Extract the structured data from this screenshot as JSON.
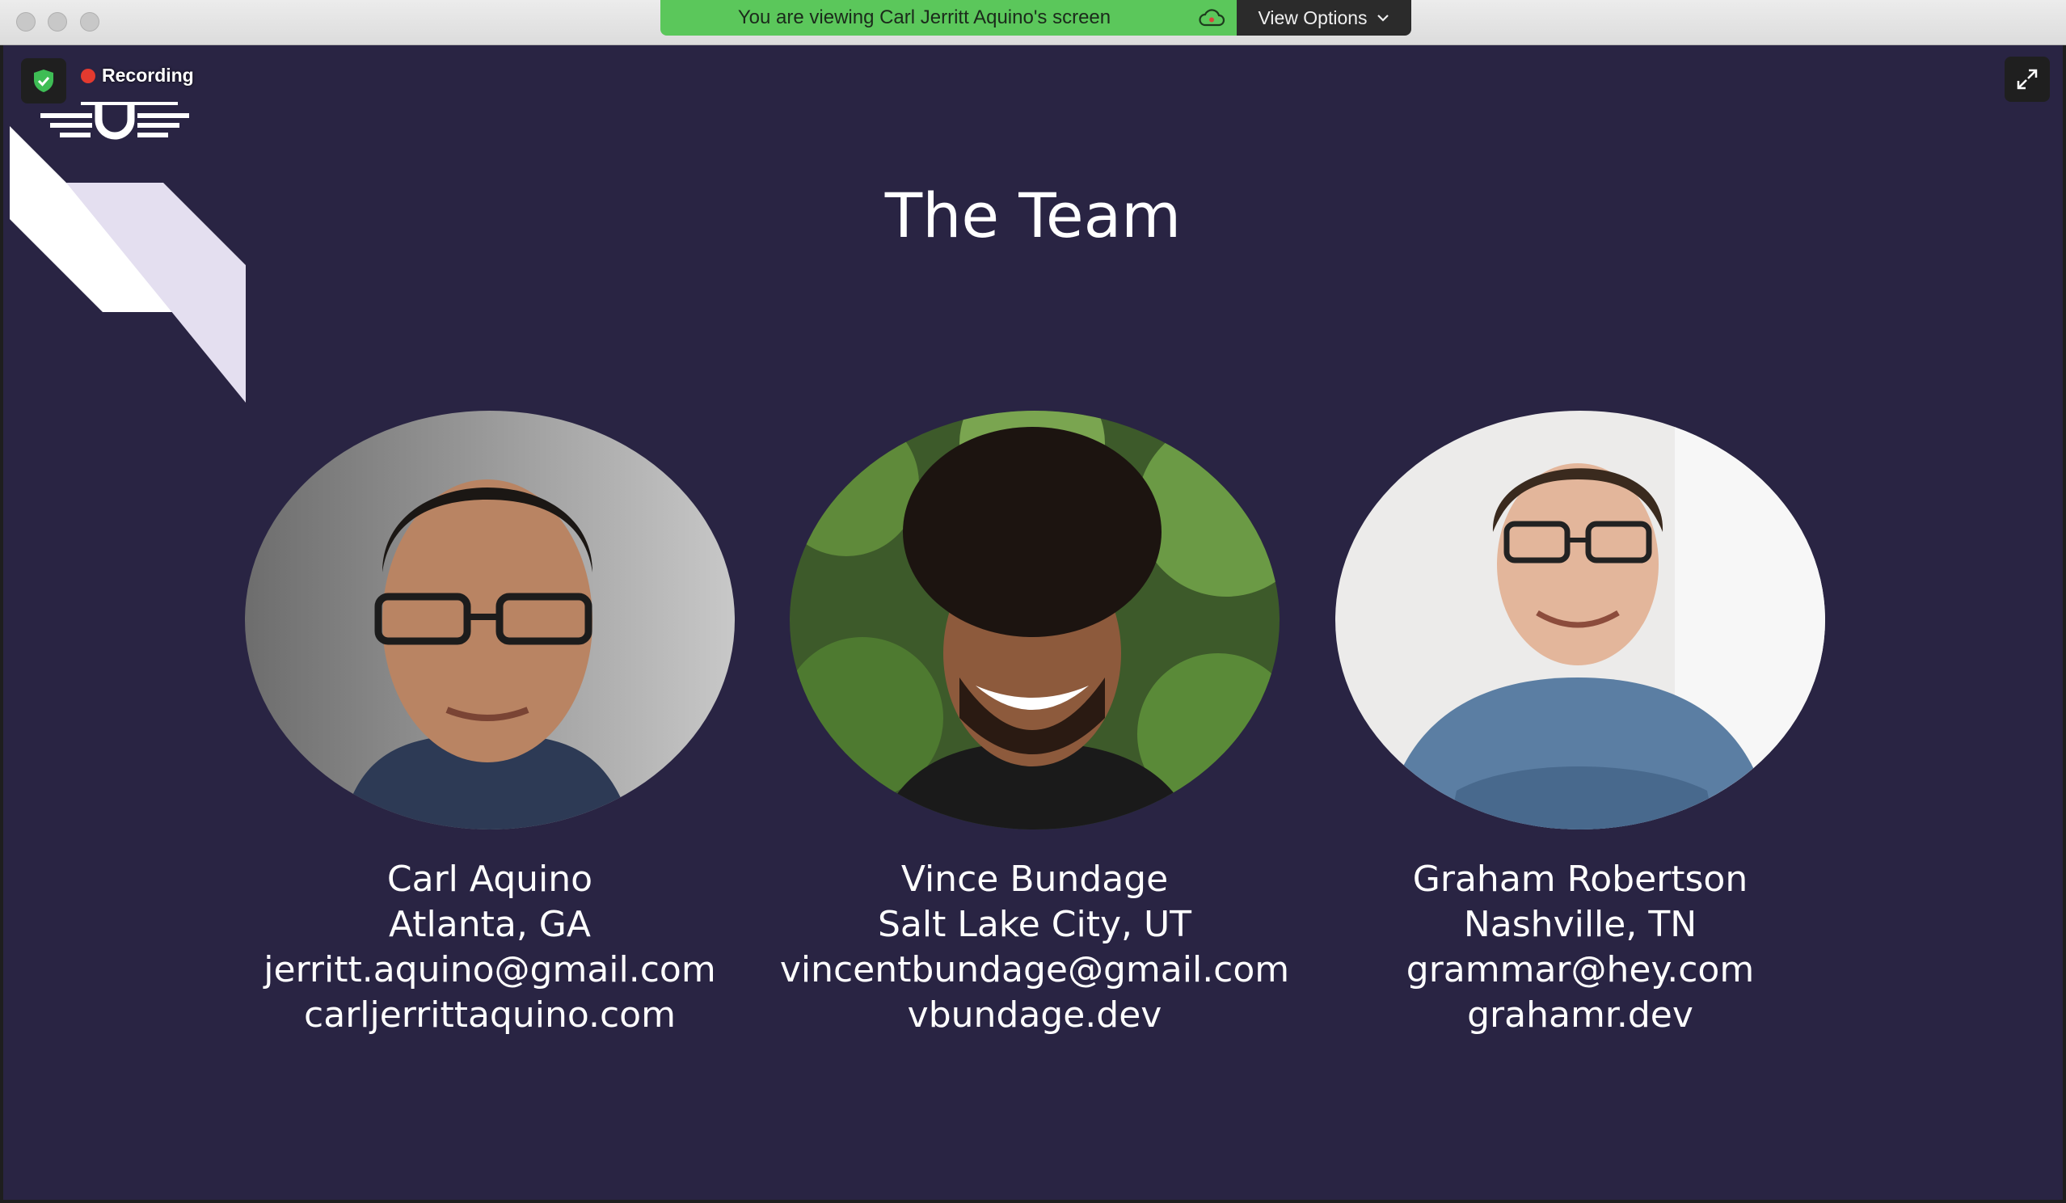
{
  "window": {
    "share_banner": "You are viewing Carl Jerritt Aquino's screen",
    "view_options": "View Options"
  },
  "meeting": {
    "recording_label": "Recording"
  },
  "slide": {
    "title": "The Team",
    "members": [
      {
        "name": "Carl Aquino",
        "location": "Atlanta, GA",
        "email": "jerritt.aquino@gmail.com",
        "website": "carljerrittaquino.com"
      },
      {
        "name": "Vince Bundage",
        "location": "Salt Lake City, UT",
        "email": "vincentbundage@gmail.com",
        "website": "vbundage.dev"
      },
      {
        "name": "Graham Robertson",
        "location": "Nashville, TN",
        "email": "grammar@hey.com",
        "website": "grahamr.dev"
      }
    ]
  },
  "icons": [
    "shield-check-icon",
    "cloud-icon",
    "chevron-down-icon",
    "expand-icon",
    "logo-icon"
  ],
  "colors": {
    "slide_background": "#292443",
    "banner_green": "#5bc75b",
    "stripe_light": "#e4dff0",
    "recording_red": "#e33a2f"
  }
}
